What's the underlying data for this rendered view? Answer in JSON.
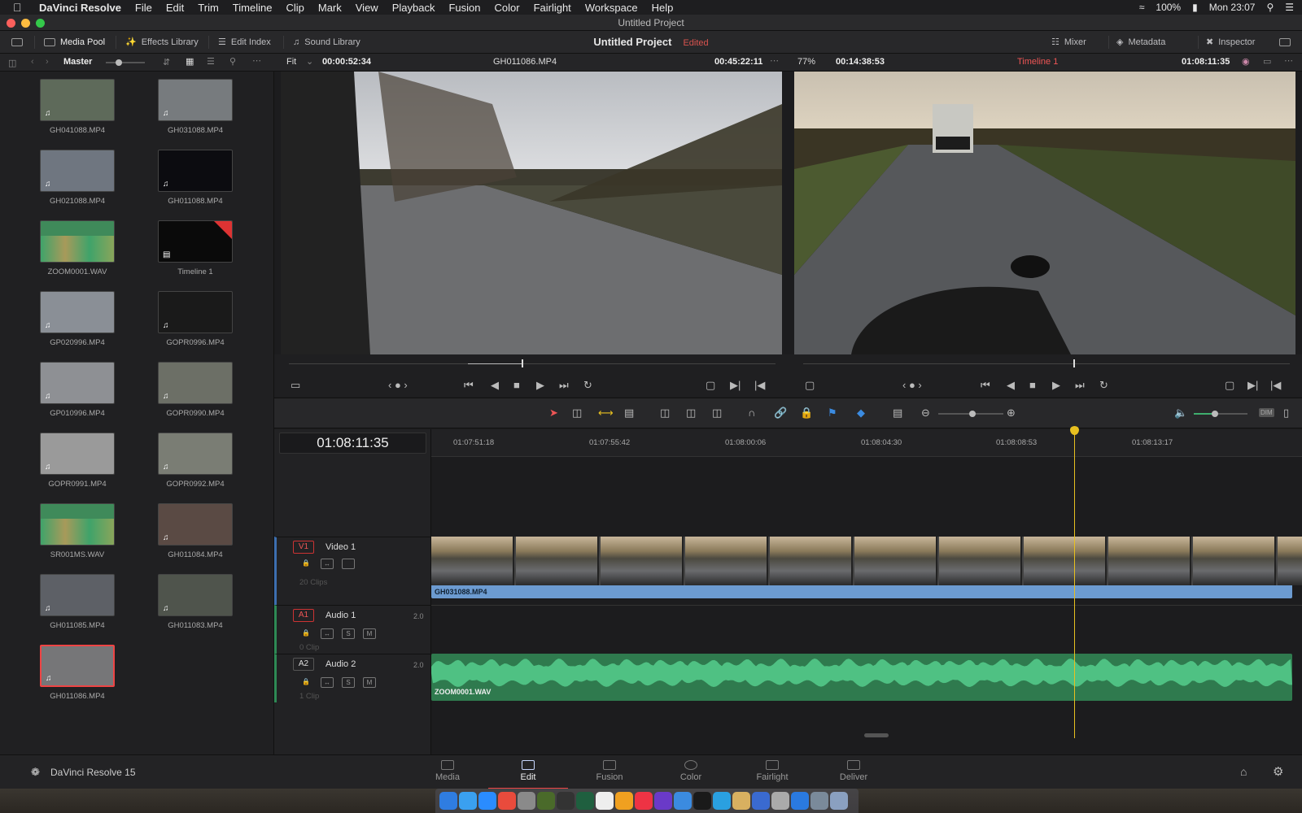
{
  "menubar": {
    "app": "DaVinci Resolve",
    "items": [
      "File",
      "Edit",
      "Trim",
      "Timeline",
      "Clip",
      "Mark",
      "View",
      "Playback",
      "Fusion",
      "Color",
      "Fairlight",
      "Workspace",
      "Help"
    ],
    "battery": "100%",
    "clock": "Mon 23:07"
  },
  "window": {
    "title": "Untitled Project"
  },
  "toolbar": {
    "media_pool": "Media Pool",
    "effects_library": "Effects Library",
    "edit_index": "Edit Index",
    "sound_library": "Sound Library",
    "project_name": "Untitled Project",
    "edited": "Edited",
    "mixer": "Mixer",
    "metadata": "Metadata",
    "inspector": "Inspector"
  },
  "subbar": {
    "bin": "Master",
    "fit": "Fit",
    "source_tc": "00:00:52:34",
    "source_clip": "GH011086.MP4",
    "source_dur": "00:45:22:11",
    "zoom": "77%",
    "record_tc": "00:14:38:53",
    "timeline_name": "Timeline 1",
    "record_dur": "01:08:11:35"
  },
  "clips": [
    {
      "name": "GH041088.MP4",
      "color": "#5e6a5a"
    },
    {
      "name": "GH031088.MP4",
      "color": "#777b7e"
    },
    {
      "name": "GH021088.MP4",
      "color": "#6f7680"
    },
    {
      "name": "GH011088.MP4",
      "color": "#0c0c10"
    },
    {
      "name": "ZOOM0001.WAV",
      "color": "#3f8a5a"
    },
    {
      "name": "Timeline 1",
      "color": "#0a0a0a"
    },
    {
      "name": "GP020996.MP4",
      "color": "#8a8f96"
    },
    {
      "name": "GOPR0996.MP4",
      "color": "#1a1a1a"
    },
    {
      "name": "GP010996.MP4",
      "color": "#8e9094"
    },
    {
      "name": "GOPR0990.MP4",
      "color": "#6c6f66"
    },
    {
      "name": "GOPR0991.MP4",
      "color": "#9a9a9a"
    },
    {
      "name": "GOPR0992.MP4",
      "color": "#7a7d74"
    },
    {
      "name": "SR001MS.WAV",
      "color": "#3f8a5a"
    },
    {
      "name": "GH011084.MP4",
      "color": "#5a4a44"
    },
    {
      "name": "GH011085.MP4",
      "color": "#5d6066"
    },
    {
      "name": "GH011083.MP4",
      "color": "#4f544c"
    },
    {
      "name": "GH011086.MP4",
      "color": "#767678"
    }
  ],
  "timeline": {
    "timecode": "01:08:11:35",
    "ruler": [
      "01:07:51:18",
      "01:07:55:42",
      "01:08:00:06",
      "01:08:04:30",
      "01:08:08:53",
      "01:08:13:17"
    ],
    "tracks": {
      "v1": {
        "badge": "V1",
        "name": "Video 1",
        "count": "20 Clips",
        "clip": "GH031088.MP4"
      },
      "a1": {
        "badge": "A1",
        "name": "Audio 1",
        "ch": "2.0",
        "count": "0 Clip"
      },
      "a2": {
        "badge": "A2",
        "name": "Audio 2",
        "ch": "2.0",
        "count": "1 Clip",
        "clip": "ZOOM0001.WAV"
      }
    }
  },
  "pages": {
    "brand": "DaVinci Resolve 15",
    "items": [
      "Media",
      "Edit",
      "Fusion",
      "Color",
      "Fairlight",
      "Deliver"
    ],
    "active": "Edit"
  },
  "colors": {
    "accent_red": "#e44",
    "audio_green": "#3fae6e",
    "video_blue": "#6c9bd0",
    "playhead": "#e8c020"
  }
}
